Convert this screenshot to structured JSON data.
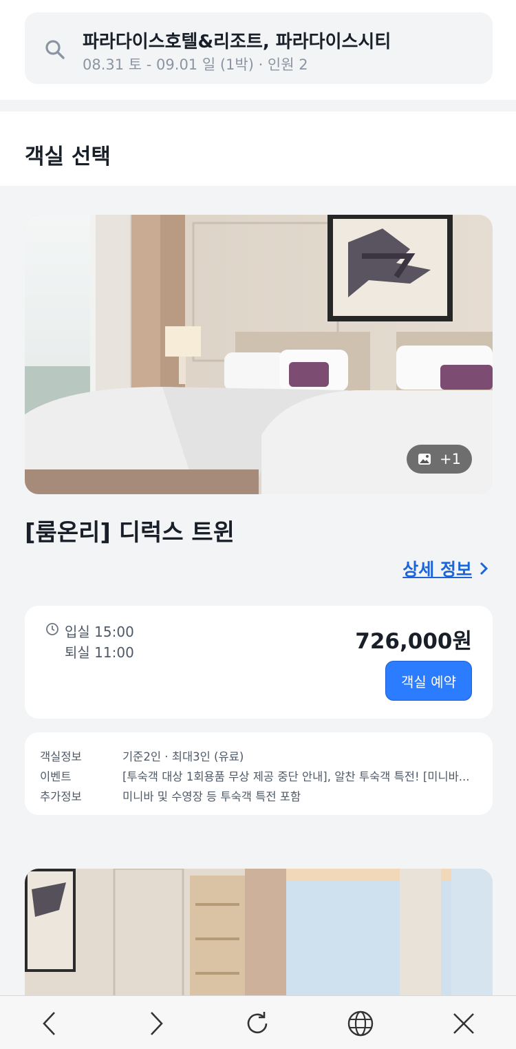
{
  "search": {
    "title": "파라다이스호텔&리조트, 파라다이스시티",
    "subtitle": "08.31 토 - 09.01 일 (1박) · 인원 2"
  },
  "section": {
    "title": "객실 선택"
  },
  "room": {
    "photo_count": "+1",
    "name": "[룸온리] 디럭스 트윈",
    "detail_link": "상세 정보",
    "checkin": "입실 15:00",
    "checkout": "퇴실 11:00",
    "price": "726,000원",
    "book_label": "객실 예약",
    "info": [
      {
        "key": "객실정보",
        "value": "기준2인 · 최대3인 (유료)"
      },
      {
        "key": "이벤트",
        "value": "[투숙객 대상 1회용품 무상 제공 중단 안내], 알찬 투숙객 특전! [미니바..."
      },
      {
        "key": "추가정보",
        "value": "미니바 및 수영장 등 투숙객 특전 포함"
      }
    ]
  },
  "colors": {
    "accent": "#2b7cff",
    "link": "#1b64da",
    "background": "#f2f4f6"
  },
  "browser_nav": [
    "back-icon",
    "forward-icon",
    "refresh-icon",
    "globe-icon",
    "close-icon"
  ]
}
